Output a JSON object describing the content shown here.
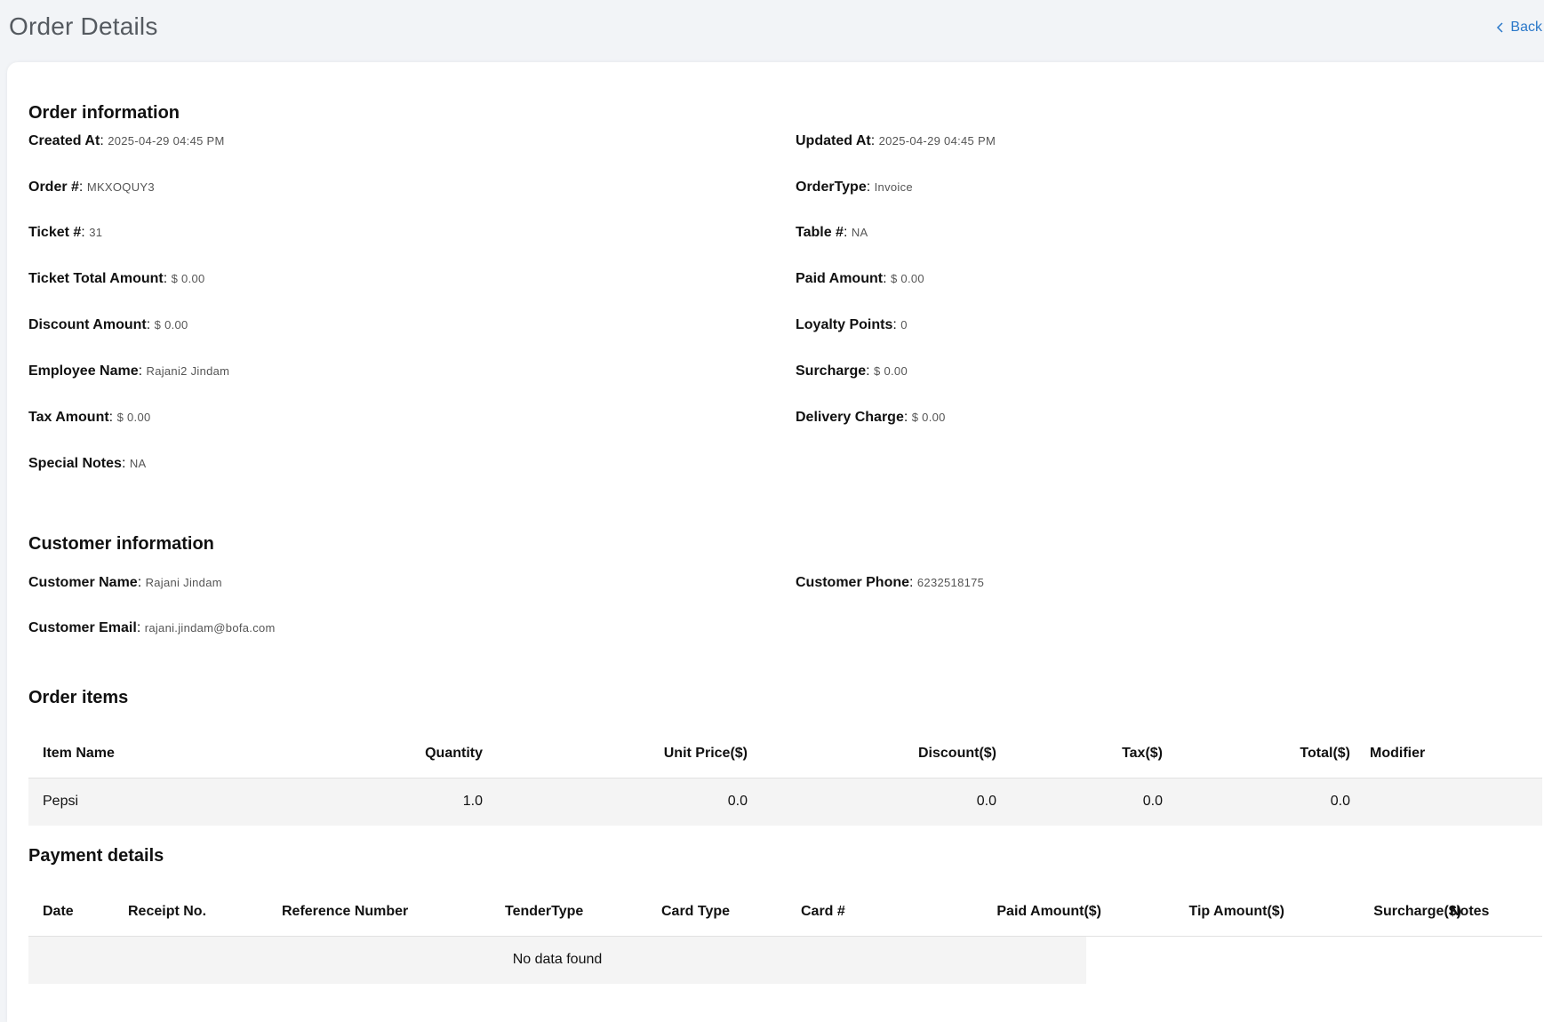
{
  "header": {
    "title": "Order Details",
    "back_label": "Back"
  },
  "order_info": {
    "title": "Order information",
    "fields": {
      "created_at": {
        "label": "Created At",
        "value": "2025-04-29 04:45 PM"
      },
      "updated_at": {
        "label": "Updated At",
        "value": "2025-04-29 04:45 PM"
      },
      "order_no": {
        "label": "Order #",
        "value": "MKXOQUY3"
      },
      "order_type": {
        "label": "OrderType",
        "value": "Invoice"
      },
      "ticket_no": {
        "label": "Ticket #",
        "value": "31"
      },
      "table_no": {
        "label": "Table #",
        "value": "NA"
      },
      "ticket_total": {
        "label": "Ticket Total Amount",
        "value": "$ 0.00"
      },
      "paid_amount": {
        "label": "Paid Amount",
        "value": "$ 0.00"
      },
      "discount_amount": {
        "label": "Discount Amount",
        "value": "$ 0.00"
      },
      "loyalty_points": {
        "label": "Loyalty Points",
        "value": "0"
      },
      "employee_name": {
        "label": "Employee Name",
        "value": "Rajani2 Jindam"
      },
      "surcharge": {
        "label": "Surcharge",
        "value": "$ 0.00"
      },
      "tax_amount": {
        "label": "Tax Amount",
        "value": "$ 0.00"
      },
      "delivery_charge": {
        "label": "Delivery Charge",
        "value": "$ 0.00"
      },
      "special_notes": {
        "label": "Special Notes",
        "value": "NA"
      }
    }
  },
  "customer_info": {
    "title": "Customer information",
    "fields": {
      "name": {
        "label": "Customer Name",
        "value": "Rajani Jindam"
      },
      "phone": {
        "label": "Customer Phone",
        "value": "6232518175"
      },
      "email": {
        "label": "Customer Email",
        "value": "rajani.jindam@bofa.com"
      }
    }
  },
  "order_items": {
    "title": "Order items",
    "columns": [
      "Item Name",
      "Quantity",
      "Unit Price($)",
      "Discount($)",
      "Tax($)",
      "Total($)",
      "Modifier"
    ],
    "rows": [
      [
        "Pepsi",
        "1.0",
        "0.0",
        "0.0",
        "0.0",
        "0.0",
        ""
      ]
    ]
  },
  "payment_details": {
    "title": "Payment details",
    "columns": [
      "Date",
      "Receipt No.",
      "Reference Number",
      "TenderType",
      "Card Type",
      "Card #",
      "Paid Amount($)",
      "Tip Amount($)",
      "Surcharge($)",
      "Notes"
    ],
    "empty_text": "No data found"
  },
  "colors": {
    "background": "#f2f4f7",
    "link": "#2b78c9",
    "row_fill": "#f4f4f4"
  }
}
